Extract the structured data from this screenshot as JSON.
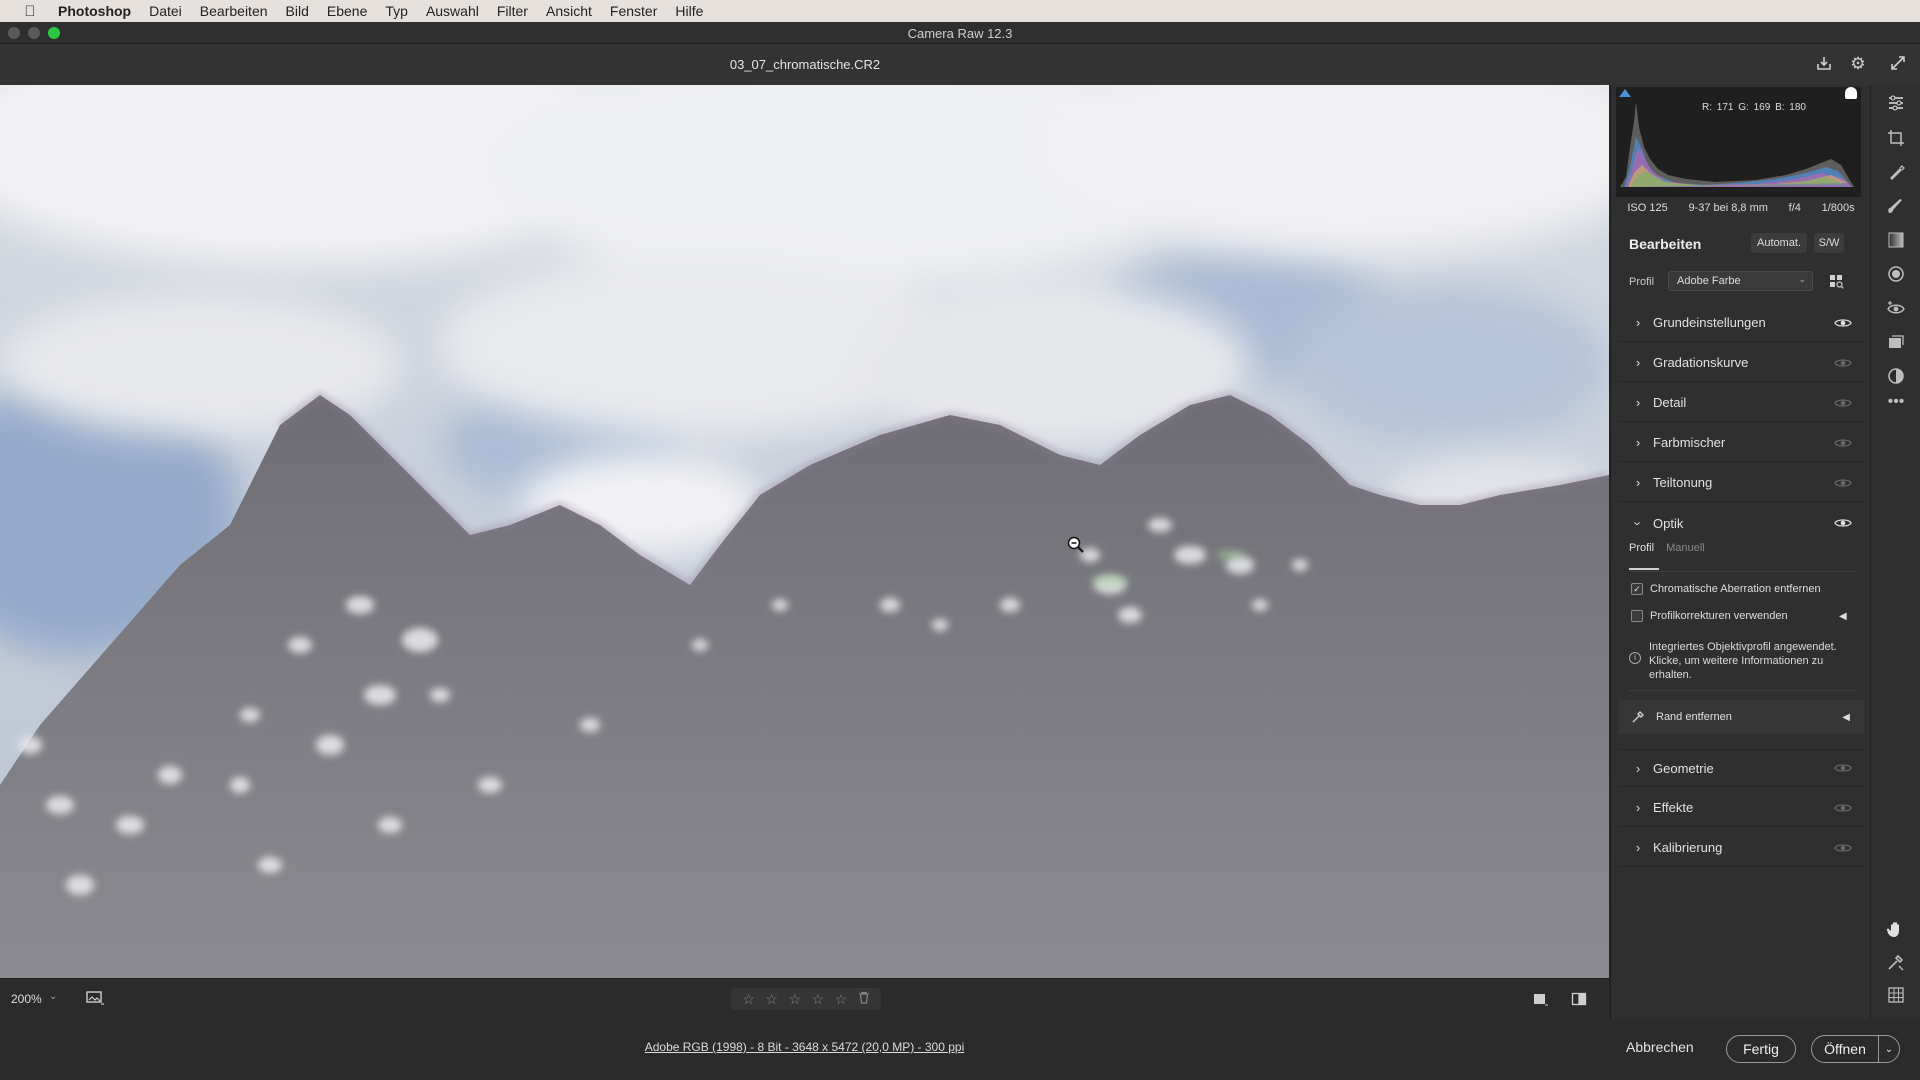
{
  "menubar": {
    "apple_icon": "apple-logo-icon",
    "items": [
      "Photoshop",
      "Datei",
      "Bearbeiten",
      "Bild",
      "Ebene",
      "Typ",
      "Auswahl",
      "Filter",
      "Ansicht",
      "Fenster",
      "Hilfe"
    ]
  },
  "window": {
    "title": "Camera Raw 12.3",
    "filename": "03_07_chromatische.CR2",
    "traffic_light_colors": [
      "#5a5a5a",
      "#5a5a5a",
      "#2ac940"
    ]
  },
  "histogram": {
    "r_label": "R:",
    "r": "171",
    "g_label": "G:",
    "g": "169",
    "b_label": "B:",
    "b": "180"
  },
  "exif": [
    "ISO 125",
    "9-37 bei 8,8 mm",
    "f/4",
    "1/800s"
  ],
  "edit": {
    "heading": "Bearbeiten",
    "auto_label": "Automat.",
    "bw_label": "S/W",
    "profile_label": "Profil",
    "profile_value": "Adobe Farbe"
  },
  "sections": [
    {
      "label": "Grundeinstellungen",
      "expanded": false,
      "eye_active": true
    },
    {
      "label": "Gradationskurve",
      "expanded": false,
      "eye_active": false
    },
    {
      "label": "Detail",
      "expanded": false,
      "eye_active": false
    },
    {
      "label": "Farbmischer",
      "expanded": false,
      "eye_active": false
    },
    {
      "label": "Teiltonung",
      "expanded": false,
      "eye_active": false
    },
    {
      "label": "Optik",
      "expanded": true,
      "eye_active": true
    }
  ],
  "optik": {
    "tab_profile": "Profil",
    "tab_manual": "Manuell",
    "ca_label": "Chromatische Aberration entfernen",
    "ca_checked": true,
    "profile_corr_label": "Profilkorrekturen verwenden",
    "profile_corr_checked": false,
    "info_text": "Integriertes Objektivprofil angewendet. Klicke, um weitere Informationen zu erhalten.",
    "defringe_label": "Rand entfernen"
  },
  "sections_after": [
    {
      "label": "Geometrie",
      "expanded": false,
      "eye_active": false
    },
    {
      "label": "Effekte",
      "expanded": false,
      "eye_active": false
    },
    {
      "label": "Kalibrierung",
      "expanded": false,
      "eye_active": false
    }
  ],
  "zoom": {
    "value": "200%"
  },
  "rating": {
    "stars": 0,
    "max": 5
  },
  "footer": {
    "info_link": "Adobe RGB (1998) - 8 Bit - 3648 x 5472 (20,0 MP) - 300 ppi",
    "cancel": "Abbrechen",
    "done": "Fertig",
    "open": "Öffnen"
  },
  "colors": {
    "accent_highlight": "#ffffff",
    "panel_bg": "#2f2f2f",
    "window_bg": "#262626"
  }
}
